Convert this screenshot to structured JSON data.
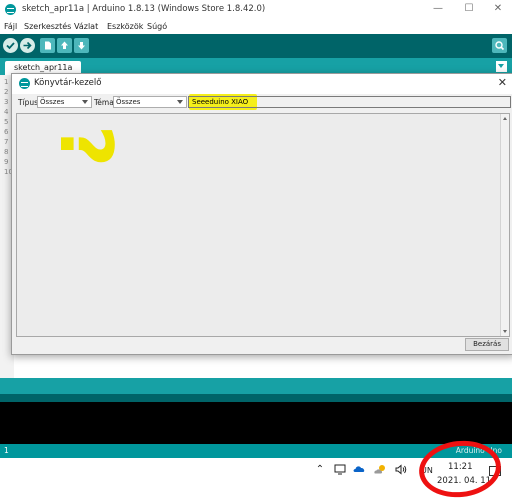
{
  "window": {
    "title": "sketch_apr11a | Arduino 1.8.13 (Windows Store 1.8.42.0)",
    "minimize_glyph": "—",
    "maximize_glyph": "☐",
    "close_glyph": "✕"
  },
  "menu": {
    "items": [
      "Fájl",
      "Szerkesztés",
      "Vázlat",
      "Eszközök",
      "Súgó"
    ]
  },
  "toolbar": {
    "buttons": [
      "verify-icon",
      "upload-icon",
      "new-icon",
      "open-icon",
      "save-icon"
    ],
    "serial_monitor_icon": "magnifier-icon"
  },
  "tabs": {
    "sketch_tab": "sketch_apr11a"
  },
  "editor": {
    "line_numbers": [
      "1",
      "2",
      "3",
      "4",
      "5",
      "6",
      "7",
      "8",
      "9",
      "10"
    ]
  },
  "dialog": {
    "title": "Könyvtár-kezelő",
    "close_glyph": "✕",
    "type_label": "Típus",
    "type_value": "Összes",
    "topic_label": "Téma",
    "topic_value": "Összes",
    "search_value": "Seeeduino XIAO",
    "annotation": "?",
    "close_button": "Bezárás"
  },
  "status": {
    "line": "1",
    "board": "Arduino Uno"
  },
  "taskbar": {
    "tray_icons": [
      "chevron-up-icon",
      "network-icon",
      "onedrive-icon",
      "weather-icon",
      "volume-icon"
    ],
    "language": "UN",
    "time": "11:21",
    "date": "2021. 04. 11."
  },
  "colors": {
    "arduino_dark_teal": "#006468",
    "arduino_teal": "#17a1a5",
    "highlight_yellow": "#f5ef1a",
    "annotation_red": "#ee1111"
  }
}
